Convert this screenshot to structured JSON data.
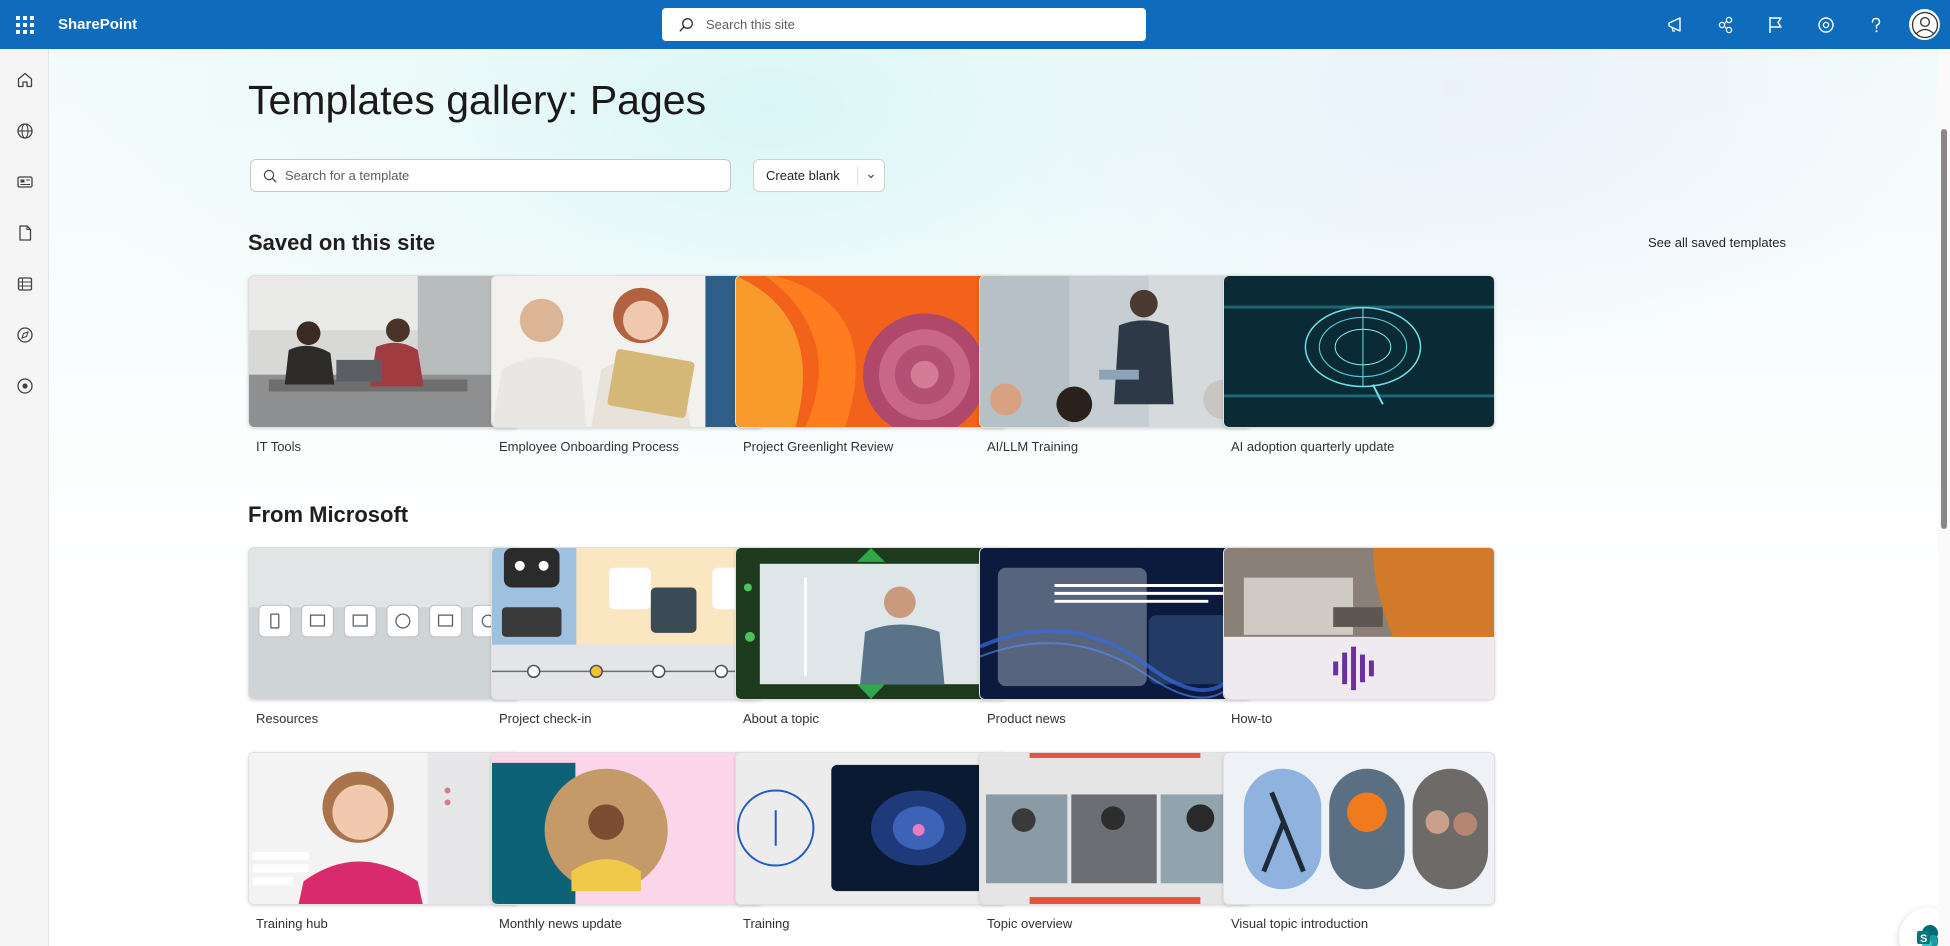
{
  "suitebar": {
    "app_name": "SharePoint",
    "search_placeholder": "Search this site",
    "icons": [
      "megaphone-icon",
      "share-network-icon",
      "flag-icon",
      "settings-icon",
      "help-icon",
      "account-icon"
    ],
    "accent": "#0f6cbd"
  },
  "rail": {
    "icons": [
      "home-icon",
      "globe-icon",
      "news-icon",
      "document-icon",
      "list-icon",
      "explore-icon",
      "create-icon"
    ]
  },
  "page": {
    "title": "Templates gallery: Pages",
    "search_placeholder": "Search for a template",
    "create_blank_label": "Create blank"
  },
  "saved": {
    "title": "Saved on this site",
    "see_all_label": "See all saved templates",
    "items": [
      {
        "label": "IT Tools",
        "image": "office-meeting-photo"
      },
      {
        "label": "Employee Onboarding Process",
        "image": "team-tablet-photo"
      },
      {
        "label": "Project Greenlight Review",
        "image": "abstract-swirl-photo"
      },
      {
        "label": "AI/LLM Training",
        "image": "presentation-room-photo"
      },
      {
        "label": "AI adoption quarterly update",
        "image": "digital-brain-photo"
      }
    ]
  },
  "microsoft": {
    "title": "From Microsoft",
    "items": [
      {
        "label": "Resources",
        "image": "resources-template"
      },
      {
        "label": "Project check-in",
        "image": "project-timeline-template"
      },
      {
        "label": "About a topic",
        "image": "engineer-photo-template"
      },
      {
        "label": "Product news",
        "image": "product-news-template"
      },
      {
        "label": "How-to",
        "image": "laptop-audio-template"
      },
      {
        "label": "Training hub",
        "image": "training-hub-template"
      },
      {
        "label": "Monthly news update",
        "image": "monthly-news-template"
      },
      {
        "label": "Training",
        "image": "training-template"
      },
      {
        "label": "Topic overview",
        "image": "topic-overview-template"
      },
      {
        "label": "Visual topic introduction",
        "image": "visual-topic-template"
      }
    ]
  }
}
